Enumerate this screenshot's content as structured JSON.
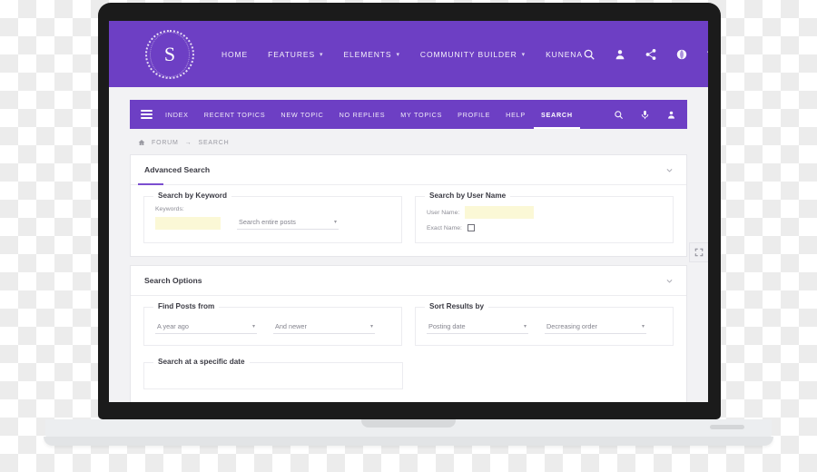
{
  "site": {
    "logo_letter": "S",
    "nav": [
      {
        "label": "HOME",
        "has_caret": false
      },
      {
        "label": "FEATURES",
        "has_caret": true
      },
      {
        "label": "ELEMENTS",
        "has_caret": true
      },
      {
        "label": "COMMUNITY BUILDER",
        "has_caret": true
      },
      {
        "label": "KUNENA",
        "has_caret": false
      }
    ],
    "icons": [
      "search-icon",
      "user-icon",
      "share-icon",
      "globe-icon",
      "menu-icon"
    ]
  },
  "forum_nav": {
    "menu_icon": "hamburger-icon",
    "links": [
      {
        "label": "INDEX",
        "active": false
      },
      {
        "label": "RECENT TOPICS",
        "active": false
      },
      {
        "label": "NEW TOPIC",
        "active": false
      },
      {
        "label": "NO REPLIES",
        "active": false
      },
      {
        "label": "MY TOPICS",
        "active": false
      },
      {
        "label": "PROFILE",
        "active": false
      },
      {
        "label": "HELP",
        "active": false
      },
      {
        "label": "SEARCH",
        "active": true
      }
    ],
    "icons": [
      "search-icon",
      "microphone-icon",
      "user-icon"
    ]
  },
  "breadcrumb": {
    "home_icon": "home-icon",
    "items": [
      "FORUM",
      "SEARCH"
    ],
    "separator": "→"
  },
  "panels": {
    "advanced_search": {
      "title": "Advanced Search",
      "toggle_icon": "chevron-down-icon",
      "keyword": {
        "legend": "Search by Keyword",
        "keywords_label": "Keywords:",
        "keywords_value": "",
        "scope_select": "Search entire posts"
      },
      "username": {
        "legend": "Search by User Name",
        "username_label": "User Name:",
        "username_value": "",
        "exact_name_label": "Exact Name:",
        "exact_name_checked": false
      }
    },
    "search_options": {
      "title": "Search Options",
      "toggle_icon": "chevron-down-icon",
      "find_posts": {
        "legend": "Find Posts from",
        "time_select": "A year ago",
        "direction_select": "And newer"
      },
      "sort_results": {
        "legend": "Sort Results by",
        "sort_select": "Posting date",
        "order_select": "Decreasing order"
      },
      "specific_date": {
        "legend": "Search at a specific date"
      }
    }
  },
  "edge_widget": {
    "icon": "fullscreen-icon"
  },
  "colors": {
    "brand_purple": "#6d3fc4",
    "accent_underline": "#7b4ed0",
    "autofill_yellow": "#fbf8d6",
    "page_bg": "#f2f2f4",
    "bezel": "#1b1b1b"
  }
}
